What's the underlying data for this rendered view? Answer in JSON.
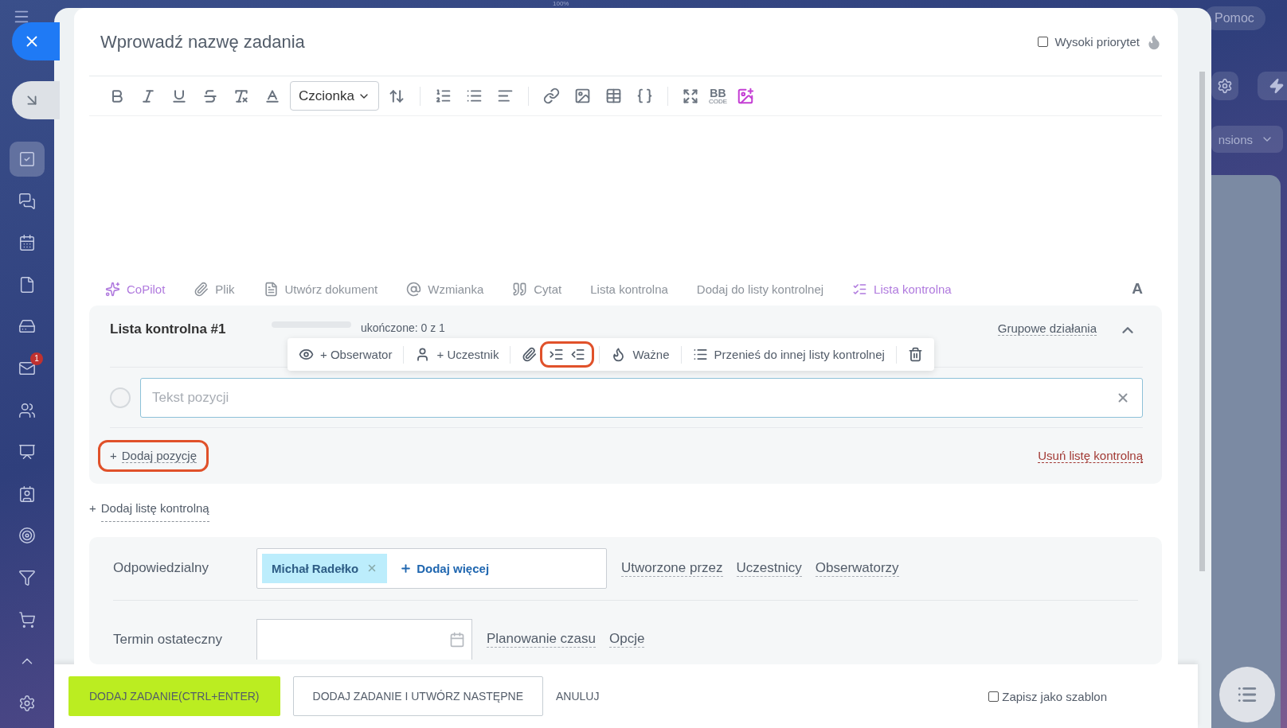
{
  "top_label": "100%",
  "nav": {
    "items": [
      {
        "selected": true
      },
      {
        "selected": false
      },
      {
        "selected": false
      },
      {
        "selected": false
      },
      {
        "selected": false
      },
      {
        "selected": false,
        "badge": "1"
      },
      {
        "selected": false
      },
      {
        "selected": false
      },
      {
        "selected": false
      },
      {
        "selected": false
      },
      {
        "selected": false
      },
      {
        "selected": false
      },
      {
        "selected": false
      },
      {
        "selected": false
      }
    ]
  },
  "right": {
    "help": "Pomoc",
    "extensions_partial": "nsions"
  },
  "task": {
    "title_placeholder": "Wprowadź nazwę zadania",
    "priority": {
      "label": "Wysoki priorytet",
      "checked": false
    }
  },
  "editor_toolbar": {
    "font_select": "Czcionka",
    "bbcode": {
      "top": "BB",
      "bottom": "CODE"
    }
  },
  "attachments": [
    {
      "label": "CoPilot",
      "kind": "copilot"
    },
    {
      "label": "Plik",
      "kind": "file"
    },
    {
      "label": "Utwórz dokument",
      "kind": "doc"
    },
    {
      "label": "Wzmianka",
      "kind": "mention"
    },
    {
      "label": "Cytat",
      "kind": "quote"
    },
    {
      "label": "Lista kontrolna",
      "kind": "plain"
    },
    {
      "label": "Dodaj do listy kontrolnej",
      "kind": "plain"
    },
    {
      "label": "Lista kontrolna",
      "kind": "checklist"
    }
  ],
  "format_toggle": "A",
  "checklist": {
    "title": "Lista kontrolna #1",
    "progress_text": "ukończone: 0 z 1",
    "level": 0,
    "group_actions": "Grupowe działania",
    "expanded": true,
    "item_toolbar": [
      {
        "buttons": [
          {
            "kind": "observer",
            "label": "+ Obserwator",
            "highlighted": false
          }
        ]
      },
      {
        "buttons": [
          {
            "kind": "participant",
            "label": "+ Uczestnik",
            "highlighted": false
          }
        ]
      },
      {
        "buttons": [
          {
            "kind": "attach",
            "highlighted": false
          },
          {
            "kind": "indent",
            "highlighted": true
          },
          {
            "kind": "outdent",
            "highlighted": true
          }
        ]
      },
      {
        "buttons": [
          {
            "kind": "important",
            "label": "Ważne",
            "highlighted": false
          }
        ]
      },
      {
        "buttons": [
          {
            "kind": "move",
            "label": "Przenieś do innej listy kontrolnej",
            "highlighted": false
          }
        ]
      },
      {
        "buttons": [
          {
            "kind": "delete",
            "highlighted": false
          }
        ]
      }
    ],
    "items": [
      {
        "placeholder": "Tekst pozycji",
        "checked": false
      }
    ],
    "add_item": {
      "plus": "+",
      "label": "Dodaj pozycję",
      "highlighted": true
    },
    "remove": "Usuń listę kontrolną"
  },
  "add_checklist": {
    "plus": "+",
    "label": "Dodaj listę kontrolną"
  },
  "fields": {
    "responsible": {
      "label": "Odpowiedzialny",
      "people": [
        {
          "name": "Michał Radełko"
        }
      ],
      "add_more": "Dodaj więcej",
      "links": [
        "Utworzone przez",
        "Uczestnicy",
        "Obserwatorzy"
      ]
    },
    "deadline": {
      "label": "Termin ostateczny",
      "links": [
        "Planowanie czasu",
        "Opcje"
      ]
    }
  },
  "footer": {
    "buttons": [
      {
        "label": "DODAJ ZADANIE(CTRL+ENTER)",
        "kind": "primary"
      },
      {
        "label": "DODAJ ZADANIE I UTWÓRZ NASTĘPNE",
        "kind": "secondary"
      },
      {
        "label": "ANULUJ",
        "kind": "link"
      }
    ],
    "template": {
      "label": "Zapisz jako szablon",
      "checked": false
    }
  }
}
